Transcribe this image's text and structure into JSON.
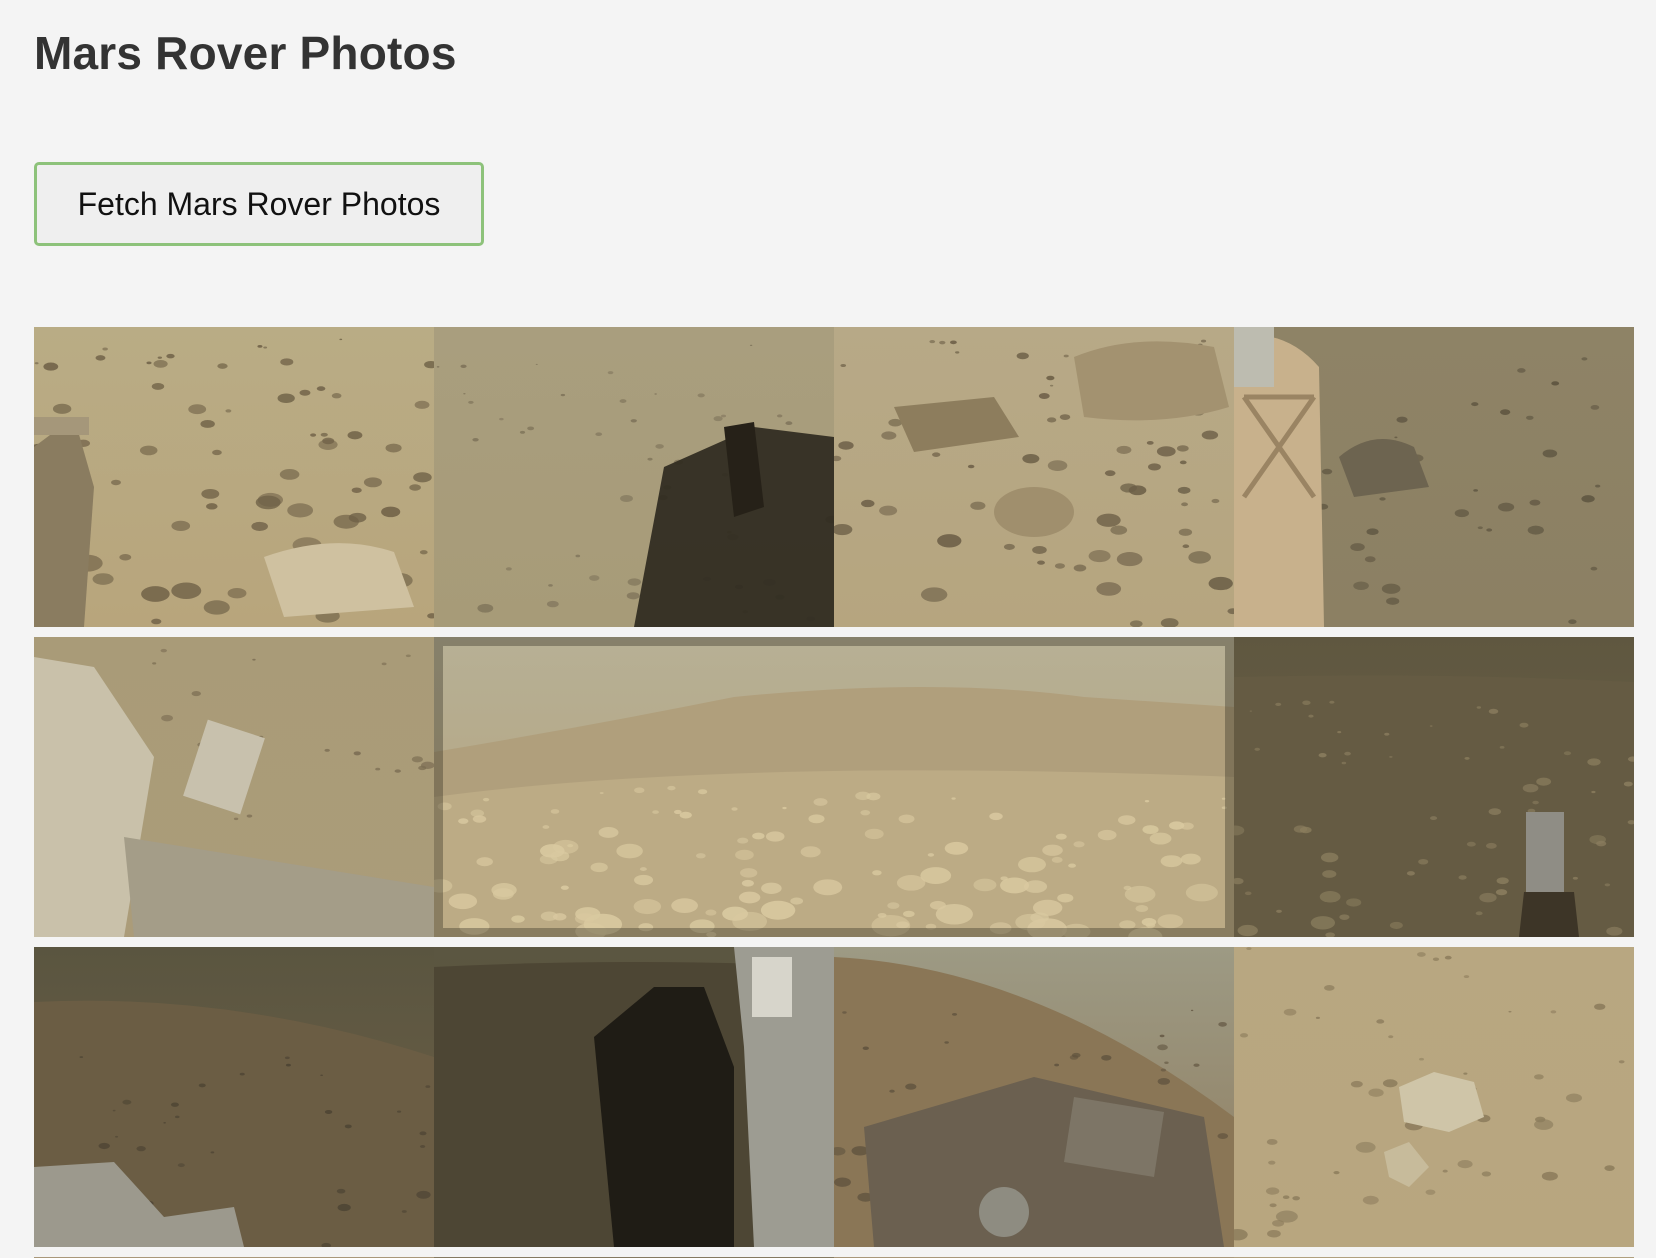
{
  "page": {
    "title": "Mars Rover Photos",
    "fetch_button_label": "Fetch Mars Rover Photos",
    "accent_color": "#8dc27a",
    "background_color": "#f4f4f4"
  },
  "gallery": {
    "photos": [
      {
        "name": "photo-rocky-field-with-rover-arm",
        "scene": "rocks-with-arm",
        "sky": "#b9ac85",
        "ground": "#b8a57c",
        "dark": "#6f6147"
      },
      {
        "name": "photo-sand-with-rover-shadow",
        "scene": "sand-shadow",
        "sky": "#a99e7e",
        "ground": "#a79b78",
        "dark": "#2f2a20"
      },
      {
        "name": "photo-boulders-on-sand",
        "scene": "boulders",
        "sky": "#b7a987",
        "ground": "#b6a57f",
        "dark": "#6c5f47"
      },
      {
        "name": "photo-rover-panel-and-rock",
        "scene": "panel-rock",
        "sky": "#8e8366",
        "ground": "#8c8063",
        "dark": "#4f4635"
      },
      {
        "name": "photo-rover-mast-close-up",
        "scene": "mast",
        "sky": "#a99b78",
        "ground": "#ab9c79",
        "dark": "#5a513f"
      },
      {
        "name": "photo-wide-crater-landscape",
        "scene": "landscape-wide",
        "sky": "#b7b095",
        "ground": "#b3a27c",
        "dark": "#7e7056"
      },
      {
        "name": "photo-dim-plain-with-sample-tube",
        "scene": "dim-plain",
        "sky": "#5f5740",
        "ground": "#6e6449",
        "dark": "#2e2a1e"
      },
      {
        "name": "photo-dark-horizon-with-rover-deck",
        "scene": "dark-horizon",
        "sky": "#5a5540",
        "ground": "#6f6147",
        "dark": "#2f2b20"
      },
      {
        "name": "photo-rover-shadow-dark",
        "scene": "shadow-dark",
        "sky": "#5b5641",
        "ground": "#595139",
        "dark": "#1f1c15"
      },
      {
        "name": "photo-rover-deck-and-hills",
        "scene": "deck-hills",
        "sky": "#9d9a84",
        "ground": "#8f7d5f",
        "dark": "#3f382b"
      },
      {
        "name": "photo-rocks-on-sand-close",
        "scene": "rocks-close",
        "sky": "#b8a781",
        "ground": "#b8a67f",
        "dark": "#7b6d51"
      },
      {
        "name": "photo-partial-row-1",
        "scene": "strip",
        "sky": "#a9987a",
        "ground": "#a9987a",
        "dark": "#6b5e47"
      },
      {
        "name": "photo-partial-row-2",
        "scene": "strip",
        "sky": "#857a60",
        "ground": "#857a60",
        "dark": "#4f4635"
      },
      {
        "name": "photo-partial-row-3",
        "scene": "strip",
        "sky": "#a9987a",
        "ground": "#a9987a",
        "dark": "#6b5e47"
      },
      {
        "name": "photo-partial-row-4",
        "scene": "strip",
        "sky": "#b0a07e",
        "ground": "#b0a07e",
        "dark": "#6b5e47"
      }
    ]
  }
}
